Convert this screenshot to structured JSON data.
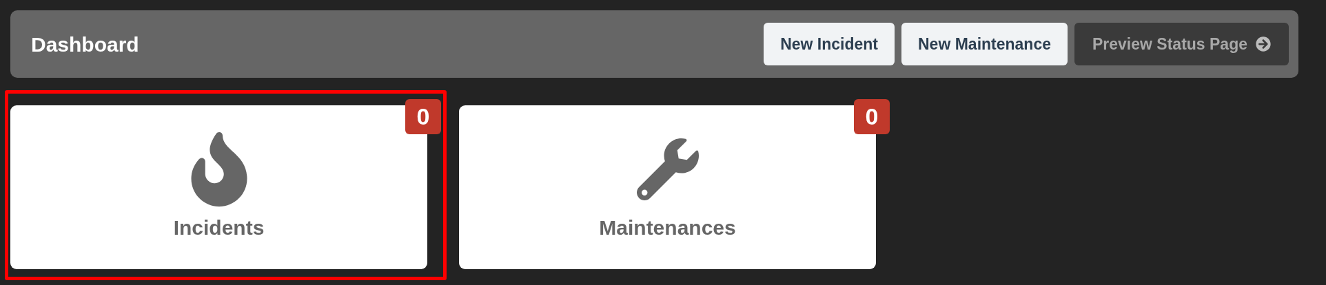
{
  "header": {
    "title": "Dashboard",
    "buttons": [
      {
        "label": "New Incident",
        "disabled": false
      },
      {
        "label": "New Maintenance",
        "disabled": false
      },
      {
        "label": "Preview Status Page",
        "disabled": true
      }
    ]
  },
  "cards": [
    {
      "kind": "incidents",
      "label": "Incidents",
      "count": "0",
      "selected": true
    },
    {
      "kind": "maintenances",
      "label": "Maintenances",
      "count": "0",
      "selected": false
    }
  ]
}
